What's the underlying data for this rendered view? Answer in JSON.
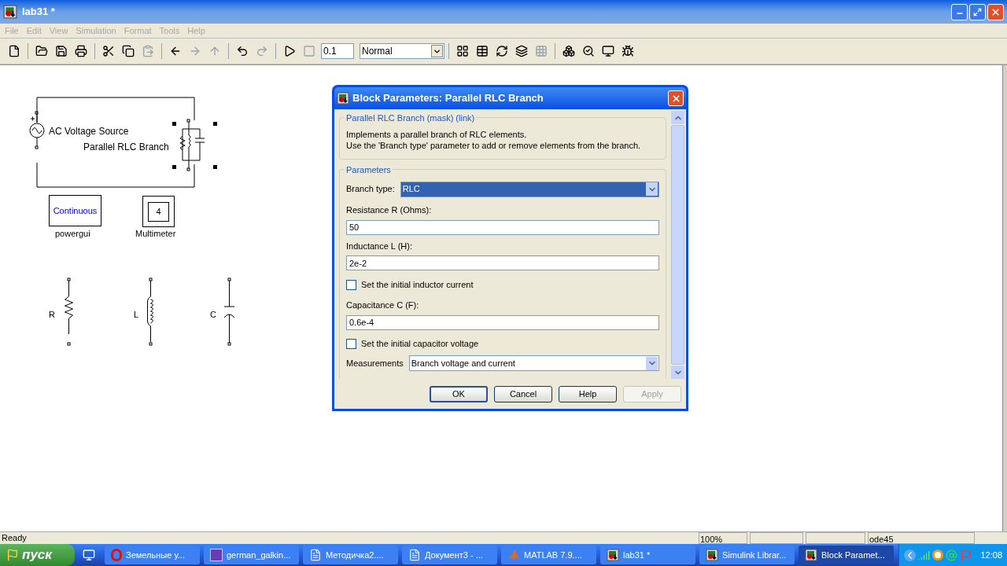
{
  "window": {
    "title": "lab31 *"
  },
  "menu": [
    "File",
    "Edit",
    "View",
    "Simulation",
    "Format",
    "Tools",
    "Help"
  ],
  "toolbar": {
    "stop_time": "0.1",
    "sim_mode": "Normal"
  },
  "diagram": {
    "blocks": [
      {
        "kind": "ac_source",
        "label": "AC Voltage Source"
      },
      {
        "kind": "parallel_rlc",
        "label": "Parallel RLC Branch",
        "selected": true
      },
      {
        "kind": "powergui",
        "text": "Continuous",
        "label": "powergui"
      },
      {
        "kind": "multimeter",
        "text": "4",
        "label": "Multimeter"
      },
      {
        "kind": "resistor",
        "label": "R"
      },
      {
        "kind": "inductor",
        "label": "L"
      },
      {
        "kind": "capacitor",
        "label": "C"
      }
    ]
  },
  "dialog": {
    "title": "Block Parameters: Parallel RLC Branch",
    "group_title": "Parallel RLC Branch (mask) (link)",
    "description": [
      "Implements a parallel branch of RLC elements.",
      "Use the 'Branch type' parameter to add or remove elements from the branch."
    ],
    "section": "Parameters",
    "params": [
      {
        "kind": "select",
        "label": "Branch type:",
        "value": "RLC",
        "focused": true
      },
      {
        "kind": "text",
        "label": "Resistance R (Ohms):",
        "value": "50"
      },
      {
        "kind": "text",
        "label": "Inductance L (H):",
        "value": "2e-2"
      },
      {
        "kind": "checkbox",
        "label": "Set the initial inductor current",
        "checked": false
      },
      {
        "kind": "text",
        "label": "Capacitance C (F):",
        "value": "0.6e-4"
      },
      {
        "kind": "checkbox",
        "label": "Set the initial capacitor voltage",
        "checked": false
      },
      {
        "kind": "select",
        "label": "Measurements",
        "value": "Branch voltage and current",
        "focused": false
      }
    ],
    "buttons": [
      {
        "label": "OK",
        "default": true,
        "disabled": false
      },
      {
        "label": "Cancel",
        "default": false,
        "disabled": false
      },
      {
        "label": "Help",
        "default": false,
        "disabled": false
      },
      {
        "label": "Apply",
        "default": false,
        "disabled": true
      }
    ]
  },
  "status_bar": {
    "status": "Ready",
    "zoom": "100%",
    "solver": "ode45"
  },
  "taskbar": {
    "start": "пуск",
    "tasks": [
      {
        "kind": "browser",
        "label": "Земельные у...",
        "selected": false
      },
      {
        "kind": "app",
        "label": "german_galkin...",
        "selected": false
      },
      {
        "kind": "document",
        "label": "Методичка2....",
        "selected": false
      },
      {
        "kind": "document",
        "label": "Документ3 - ...",
        "selected": false
      },
      {
        "kind": "matlab",
        "label": "MATLAB  7.9....",
        "selected": false
      },
      {
        "kind": "model",
        "label": "lab31 *",
        "selected": false
      },
      {
        "kind": "model",
        "label": "Simulink Librar...",
        "selected": false
      },
      {
        "kind": "model",
        "label": "Block Paramet...",
        "selected": true
      }
    ],
    "clock": "12:08"
  }
}
